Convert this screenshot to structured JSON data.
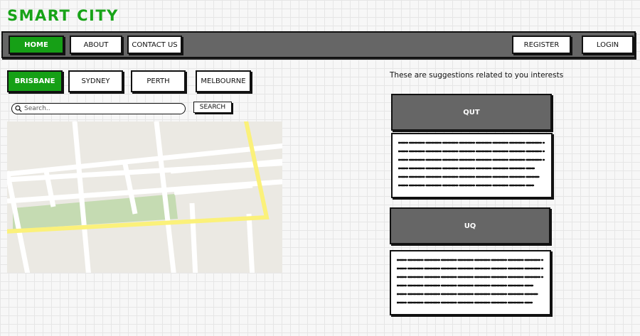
{
  "app": {
    "title": "SMART CITY"
  },
  "nav": {
    "left_items": [
      {
        "label": "HOME",
        "active": true
      },
      {
        "label": "ABOUT",
        "active": false
      },
      {
        "label": "CONTACT US",
        "active": false
      }
    ],
    "right_items": [
      {
        "label": "REGISTER"
      },
      {
        "label": "LOGIN"
      }
    ]
  },
  "cities": [
    {
      "label": "BRISBANE",
      "active": true
    },
    {
      "label": "SYDNEY",
      "active": false
    },
    {
      "label": "PERTH",
      "active": false
    },
    {
      "label": "MELBOURNE",
      "active": false
    }
  ],
  "search": {
    "placeholder": "Search..",
    "value": "",
    "button_label": "SEARCH"
  },
  "map": {
    "icon": "map-image"
  },
  "suggestions": {
    "heading": "These are suggestions related to you interests",
    "cards": [
      {
        "title": "QUT"
      },
      {
        "title": "UQ"
      }
    ]
  },
  "colors": {
    "accent": "#16a016",
    "navbar": "#666666",
    "card_header": "#666666"
  }
}
